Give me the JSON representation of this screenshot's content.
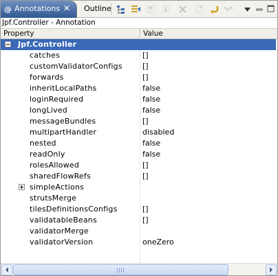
{
  "tabs": {
    "active_label": "Annotations",
    "active_icon": "@",
    "close_glyph": "✕",
    "inactive_label": "Outline"
  },
  "toolbar": {
    "icons": [
      "tree-view-icon",
      "filter-icon",
      "move-up-icon",
      "move-down-icon",
      "delete-icon",
      "add-icon",
      "undo-icon",
      "redo-icon",
      "menu-icon"
    ]
  },
  "context_label": "Jpf.Controller - Annotation",
  "columns": {
    "property": "Property",
    "value": "Value"
  },
  "root": {
    "property": "Jpf.Controller",
    "value": ""
  },
  "rows": [
    {
      "property": "catches",
      "value": "[]",
      "expandable": false
    },
    {
      "property": "customValidatorConfigs",
      "value": "[]",
      "expandable": false
    },
    {
      "property": "forwards",
      "value": "[]",
      "expandable": false
    },
    {
      "property": "inheritLocalPaths",
      "value": "false",
      "expandable": false
    },
    {
      "property": "loginRequired",
      "value": "false",
      "expandable": false
    },
    {
      "property": "longLived",
      "value": "false",
      "expandable": false
    },
    {
      "property": "messageBundles",
      "value": "[]",
      "expandable": false
    },
    {
      "property": "multipartHandler",
      "value": "disabled",
      "expandable": false
    },
    {
      "property": "nested",
      "value": "false",
      "expandable": false
    },
    {
      "property": "readOnly",
      "value": "false",
      "expandable": false
    },
    {
      "property": "rolesAllowed",
      "value": "[]",
      "expandable": false
    },
    {
      "property": "sharedFlowRefs",
      "value": "[]",
      "expandable": false
    },
    {
      "property": "simpleActions",
      "value": "",
      "expandable": true
    },
    {
      "property": "strutsMerge",
      "value": "",
      "expandable": false
    },
    {
      "property": "tilesDefinitionsConfigs",
      "value": "[]",
      "expandable": false
    },
    {
      "property": "validatableBeans",
      "value": "[]",
      "expandable": false
    },
    {
      "property": "validatorMerge",
      "value": "",
      "expandable": false
    },
    {
      "property": "validatorVersion",
      "value": "oneZero",
      "expandable": false
    }
  ],
  "colors": {
    "selection": "#3a69b6",
    "tab_active": "#315892"
  }
}
